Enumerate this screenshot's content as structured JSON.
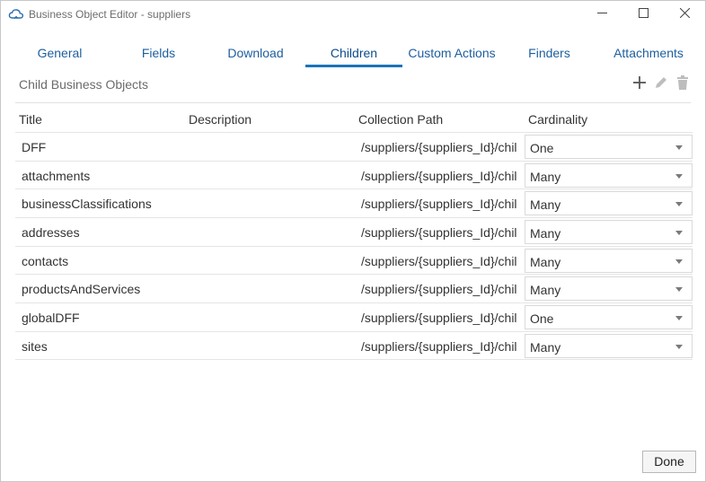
{
  "window": {
    "title": "Business Object Editor - suppliers",
    "controls": [
      "minimize-icon",
      "maximize-icon",
      "close-icon"
    ]
  },
  "tabs": [
    {
      "label": "General",
      "active": false
    },
    {
      "label": "Fields",
      "active": false
    },
    {
      "label": "Download",
      "active": false
    },
    {
      "label": "Children",
      "active": true
    },
    {
      "label": "Custom Actions",
      "active": false
    },
    {
      "label": "Finders",
      "active": false
    },
    {
      "label": "Attachments",
      "active": false
    }
  ],
  "section": {
    "title": "Child Business Objects",
    "toolbar_icons": [
      "add-icon",
      "edit-icon",
      "delete-icon"
    ]
  },
  "table": {
    "columns": [
      "Title",
      "Description",
      "Collection Path",
      "Cardinality"
    ],
    "rows": [
      {
        "title": "DFF",
        "description": "",
        "path": "/suppliers/{suppliers_Id}/chil",
        "cardinality": "One"
      },
      {
        "title": "attachments",
        "description": "",
        "path": "/suppliers/{suppliers_Id}/chil",
        "cardinality": "Many"
      },
      {
        "title": "businessClassifications",
        "description": "",
        "path": "/suppliers/{suppliers_Id}/chil",
        "cardinality": "Many"
      },
      {
        "title": "addresses",
        "description": "",
        "path": "/suppliers/{suppliers_Id}/chil",
        "cardinality": "Many"
      },
      {
        "title": "contacts",
        "description": "",
        "path": "/suppliers/{suppliers_Id}/chil",
        "cardinality": "Many"
      },
      {
        "title": "productsAndServices",
        "description": "",
        "path": "/suppliers/{suppliers_Id}/chil",
        "cardinality": "Many"
      },
      {
        "title": "globalDFF",
        "description": "",
        "path": "/suppliers/{suppliers_Id}/chil",
        "cardinality": "One"
      },
      {
        "title": "sites",
        "description": "",
        "path": "/suppliers/{suppliers_Id}/chil",
        "cardinality": "Many"
      }
    ]
  },
  "footer": {
    "done_label": "Done"
  },
  "colors": {
    "accent": "#1a73b8",
    "tab_text": "#1e5fa0",
    "border": "#e5e5e5"
  }
}
